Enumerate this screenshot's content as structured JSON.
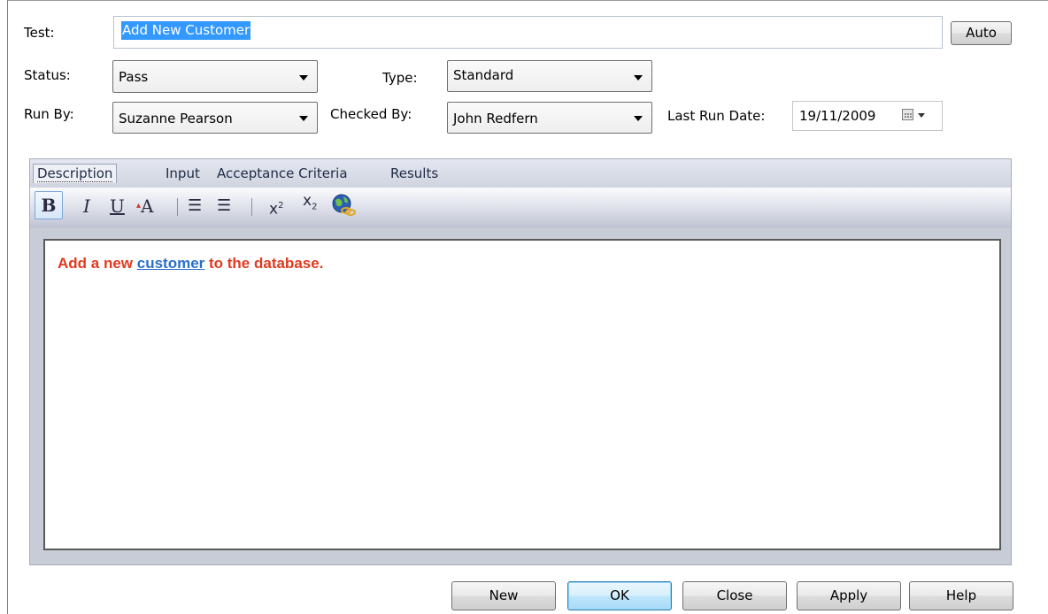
{
  "form": {
    "test_label": "Test:",
    "test_value": "Add New Customer",
    "auto_button": "Auto",
    "status_label": "Status:",
    "status_value": "Pass",
    "type_label": "Type:",
    "type_value": "Standard",
    "runby_label": "Run By:",
    "runby_value": "Suzanne Pearson",
    "checkedby_label": "Checked By:",
    "checkedby_value": "John Redfern",
    "lastrun_label": "Last Run Date:",
    "lastrun_value": "19/11/2009"
  },
  "tabs": [
    {
      "label": "Description",
      "active": true
    },
    {
      "label": "Input"
    },
    {
      "label": "Acceptance Criteria"
    },
    {
      "label": "Results"
    }
  ],
  "toolbar": {
    "bold": "B",
    "italic": "I",
    "underline": "U",
    "font_color": "A",
    "bullets": "☰",
    "numbered": "☰",
    "superscript_base": "x",
    "superscript_exp": "2",
    "subscript_base": "x",
    "subscript_exp": "2"
  },
  "editor": {
    "before": "Add a new ",
    "link": "customer",
    "after": " to the database."
  },
  "buttons": {
    "new": "New",
    "ok": "OK",
    "close": "Close",
    "apply": "Apply",
    "help": "Help"
  }
}
